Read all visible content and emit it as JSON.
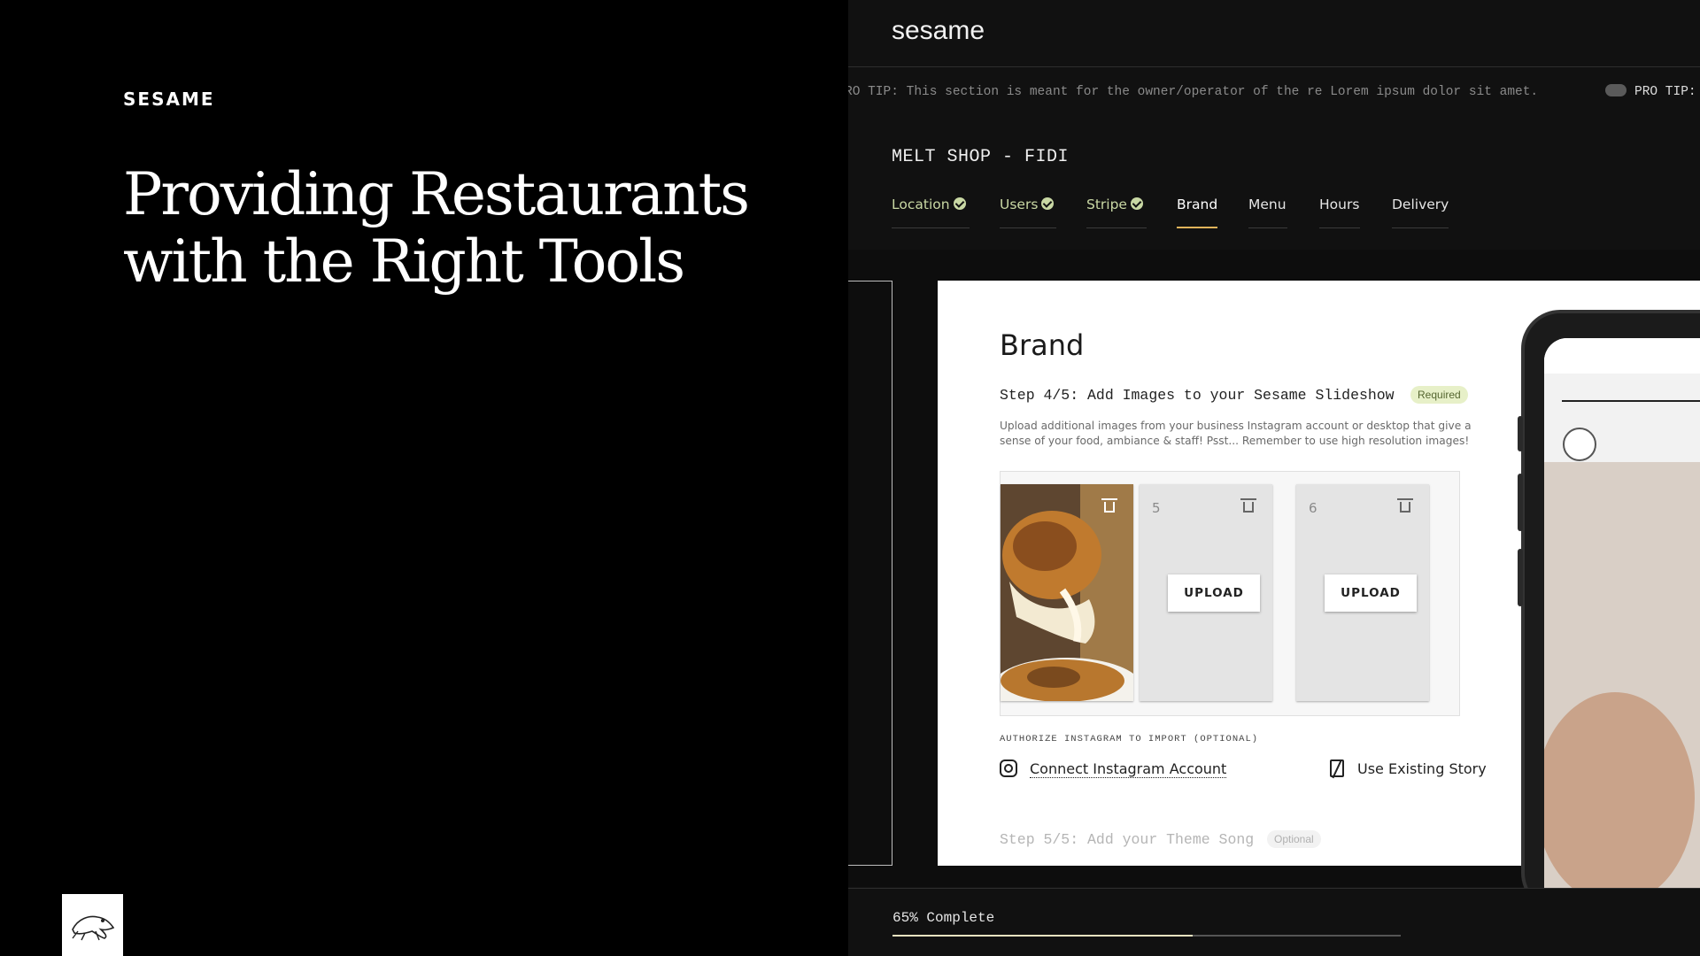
{
  "left": {
    "brand": "SESAME",
    "headline_line1": "Providing Restaurants",
    "headline_line2": "with the Right Tools",
    "logo_icon": "frog-icon"
  },
  "app": {
    "logo": "sesame",
    "protip": "RO TIP: This section is meant for the owner/operator of the re Lorem ipsum dolor sit amet.",
    "protip_tail": "PRO TIP:",
    "shop_name": "MELT SHOP - FIDI",
    "tabs": [
      {
        "label": "Location",
        "status": "complete"
      },
      {
        "label": "Users",
        "status": "complete"
      },
      {
        "label": "Stripe",
        "status": "complete"
      },
      {
        "label": "Brand",
        "status": "active"
      },
      {
        "label": "Menu",
        "status": "pending"
      },
      {
        "label": "Hours",
        "status": "pending"
      },
      {
        "label": "Delivery",
        "status": "pending"
      }
    ]
  },
  "brand_card": {
    "title": "Brand",
    "step_label": "Step 4/5: Add Images to your Sesame Slideshow",
    "required_badge": "Required",
    "description": "Upload additional images from your business Instagram account or desktop that give a sense of your food, ambiance & staff! Psst... Remember to use high resolution images!",
    "tiles": [
      {
        "number": "",
        "has_image": true
      },
      {
        "number": "5",
        "upload_label": "UPLOAD"
      },
      {
        "number": "6",
        "upload_label": "UPLOAD"
      }
    ],
    "instagram_label": "AUTHORIZE INSTAGRAM TO IMPORT (OPTIONAL)",
    "connect_instagram": "Connect Instagram Account",
    "use_existing_story": "Use Existing Story",
    "next_step_label": "Step 5/5: Add your Theme Song",
    "optional_badge": "Optional"
  },
  "progress": {
    "label": "65% Complete",
    "value": 0.59
  },
  "colors": {
    "accent_gold": "#e0b35a",
    "complete_green": "#c9d8a4",
    "required_badge_bg": "#e7f0c8"
  }
}
